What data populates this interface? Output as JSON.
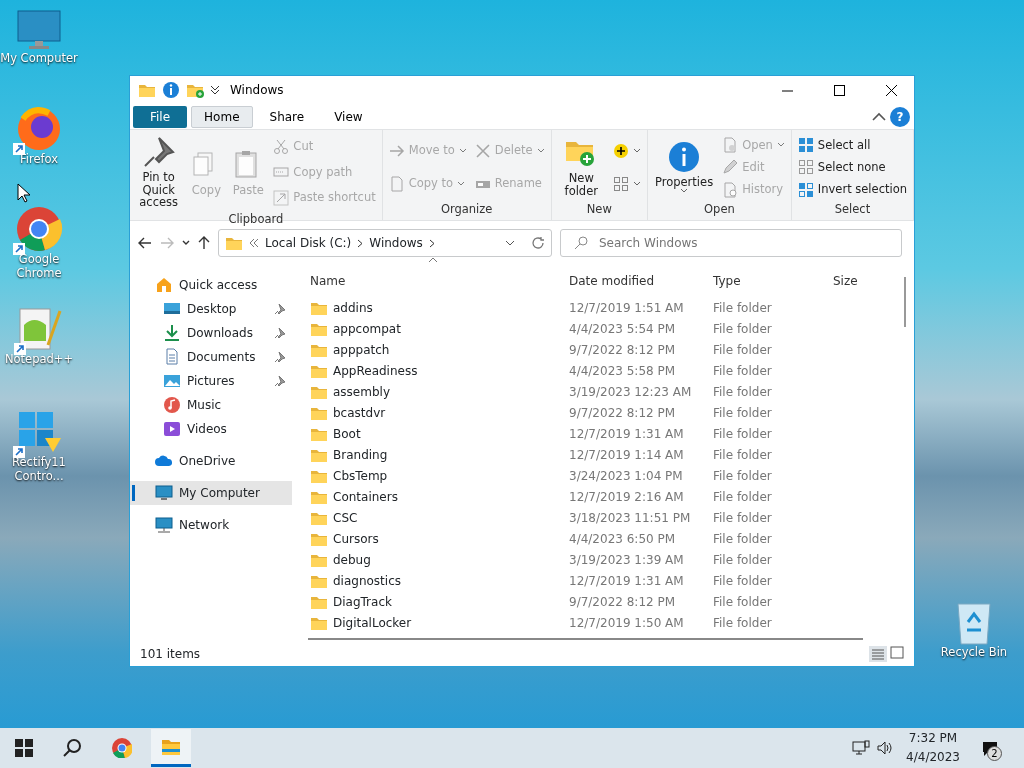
{
  "desktop_icons": [
    {
      "label": "My Computer",
      "shortcut": false
    },
    {
      "label": "Firefox",
      "shortcut": true
    },
    {
      "label": "Google Chrome",
      "shortcut": true
    },
    {
      "label": "Notepad++",
      "shortcut": true
    },
    {
      "label": "Rectify11 Contro...",
      "shortcut": true
    },
    {
      "label": "Recycle Bin",
      "shortcut": false
    }
  ],
  "window": {
    "title": "Windows",
    "ribbon_tabs": [
      {
        "label": "File",
        "kind": "file",
        "selected": false
      },
      {
        "label": "Home",
        "kind": "tab",
        "selected": true
      },
      {
        "label": "Share",
        "kind": "tab",
        "selected": false
      },
      {
        "label": "View",
        "kind": "tab",
        "selected": false
      }
    ],
    "ribbon_groups": [
      {
        "label": "Clipboard",
        "columns": [
          [
            {
              "kind": "large",
              "label": "Pin to Quick access",
              "disabled": false
            }
          ],
          [
            {
              "kind": "large",
              "label": "Copy",
              "disabled": true
            }
          ],
          [
            {
              "kind": "large",
              "label": "Paste",
              "disabled": true
            }
          ],
          [
            {
              "kind": "small",
              "label": "Cut",
              "disabled": true
            },
            {
              "kind": "small",
              "label": "Copy path",
              "disabled": true
            },
            {
              "kind": "small",
              "label": "Paste shortcut",
              "disabled": true
            }
          ]
        ]
      },
      {
        "label": "Organize",
        "columns": [
          [
            {
              "kind": "small",
              "label": "Move to",
              "disabled": true,
              "dropdown": true
            },
            {
              "kind": "small",
              "label": "Copy to",
              "disabled": true,
              "dropdown": true
            }
          ],
          [
            {
              "kind": "small",
              "label": "Delete",
              "disabled": true,
              "dropdown": true
            },
            {
              "kind": "small",
              "label": "Rename",
              "disabled": true
            }
          ]
        ]
      },
      {
        "label": "New",
        "columns": [
          [
            {
              "kind": "large",
              "label": "New folder",
              "disabled": false
            }
          ],
          [
            {
              "kind": "icon",
              "disabled": false,
              "dropdown": true
            },
            {
              "kind": "icon",
              "disabled": false,
              "dropdown": true
            }
          ]
        ]
      },
      {
        "label": "Open",
        "columns": [
          [
            {
              "kind": "large",
              "label": "Properties",
              "disabled": false,
              "dropdown": true
            }
          ],
          [
            {
              "kind": "small",
              "label": "Open",
              "disabled": true,
              "dropdown": true
            },
            {
              "kind": "small",
              "label": "Edit",
              "disabled": true
            },
            {
              "kind": "small",
              "label": "History",
              "disabled": true
            }
          ]
        ]
      },
      {
        "label": "Select",
        "columns": [
          [
            {
              "kind": "small",
              "label": "Select all",
              "disabled": false
            },
            {
              "kind": "small",
              "label": "Select none",
              "disabled": false
            },
            {
              "kind": "small",
              "label": "Invert selection",
              "disabled": false
            }
          ]
        ]
      }
    ],
    "help": "?",
    "address": [
      "Local Disk (C:)",
      "Windows"
    ],
    "search": {
      "placeholder": "Search Windows"
    },
    "nav": [
      {
        "label": "Quick access",
        "selected": false,
        "children": [
          {
            "label": "Desktop",
            "pinned": true,
            "selected": false
          },
          {
            "label": "Downloads",
            "pinned": true,
            "selected": false
          },
          {
            "label": "Documents",
            "pinned": true,
            "selected": false
          },
          {
            "label": "Pictures",
            "pinned": true,
            "selected": false
          },
          {
            "label": "Music",
            "pinned": false,
            "selected": false
          },
          {
            "label": "Videos",
            "pinned": false,
            "selected": false
          }
        ]
      },
      {
        "label": "OneDrive",
        "selected": false
      },
      {
        "label": "My Computer",
        "selected": true
      },
      {
        "label": "Network",
        "selected": false
      }
    ],
    "columns": [
      {
        "label": "Name",
        "sorted": true
      },
      {
        "label": "Date modified",
        "sorted": false
      },
      {
        "label": "Type",
        "sorted": false
      },
      {
        "label": "Size",
        "sorted": false
      }
    ],
    "rows": [
      {
        "name": "addins",
        "date": "12/7/2019 1:51 AM",
        "type": "File folder"
      },
      {
        "name": "appcompat",
        "date": "4/4/2023 5:54 PM",
        "type": "File folder"
      },
      {
        "name": "apppatch",
        "date": "9/7/2022 8:12 PM",
        "type": "File folder"
      },
      {
        "name": "AppReadiness",
        "date": "4/4/2023 5:58 PM",
        "type": "File folder"
      },
      {
        "name": "assembly",
        "date": "3/19/2023 12:23 AM",
        "type": "File folder"
      },
      {
        "name": "bcastdvr",
        "date": "9/7/2022 8:12 PM",
        "type": "File folder"
      },
      {
        "name": "Boot",
        "date": "12/7/2019 1:31 AM",
        "type": "File folder"
      },
      {
        "name": "Branding",
        "date": "12/7/2019 1:14 AM",
        "type": "File folder"
      },
      {
        "name": "CbsTemp",
        "date": "3/24/2023 1:04 PM",
        "type": "File folder"
      },
      {
        "name": "Containers",
        "date": "12/7/2019 2:16 AM",
        "type": "File folder"
      },
      {
        "name": "CSC",
        "date": "3/18/2023 11:51 PM",
        "type": "File folder"
      },
      {
        "name": "Cursors",
        "date": "4/4/2023 6:50 PM",
        "type": "File folder"
      },
      {
        "name": "debug",
        "date": "3/19/2023 1:39 AM",
        "type": "File folder"
      },
      {
        "name": "diagnostics",
        "date": "12/7/2019 1:31 AM",
        "type": "File folder"
      },
      {
        "name": "DiagTrack",
        "date": "9/7/2022 8:12 PM",
        "type": "File folder"
      },
      {
        "name": "DigitalLocker",
        "date": "12/7/2019 1:50 AM",
        "type": "File folder"
      }
    ],
    "status": "101 items"
  },
  "taskbar": {
    "apps": [
      {
        "kind": "start",
        "active": false
      },
      {
        "kind": "search",
        "active": false
      },
      {
        "kind": "browser",
        "active": false
      },
      {
        "kind": "explorer",
        "active": true
      }
    ],
    "time": "7:32 PM",
    "date": "4/4/2023",
    "notifications": "2"
  }
}
